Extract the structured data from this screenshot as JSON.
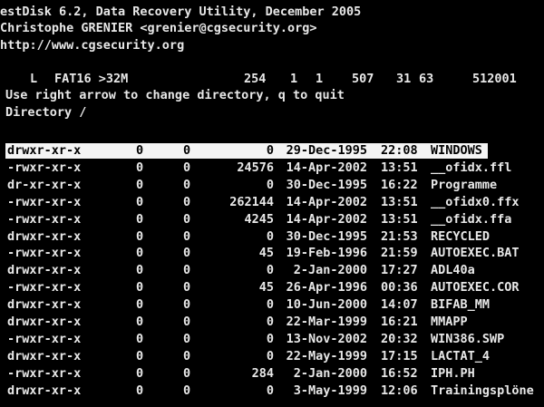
{
  "header": {
    "line1": "estDisk 6.2, Data Recovery Utility, December 2005",
    "line2": "Christophe GRENIER <grenier@cgsecurity.org>",
    "line3": "http://www.cgsecurity.org"
  },
  "partition": {
    "flag": "L",
    "type": "FAT16 >32M",
    "cyl_start": "254",
    "head_start": "1",
    "sec_start": "1",
    "cyl_end": "507",
    "head_end": "31",
    "sec_end": "63",
    "size": "512001"
  },
  "help_text": "Use right arrow to change directory, q to quit",
  "directory_label": "Directory /",
  "entries": [
    {
      "perm": "drwxr-xr-x",
      "uid": "0",
      "gid": "0",
      "size": "0",
      "date": "29-Dec-1995",
      "time": "22:08",
      "name": "WINDOWS"
    },
    {
      "perm": "-rwxr-xr-x",
      "uid": "0",
      "gid": "0",
      "size": "24576",
      "date": "14-Apr-2002",
      "time": "13:51",
      "name": "__ofidx.ffl"
    },
    {
      "perm": "dr-xr-xr-x",
      "uid": "0",
      "gid": "0",
      "size": "0",
      "date": "30-Dec-1995",
      "time": "16:22",
      "name": "Programme"
    },
    {
      "perm": "-rwxr-xr-x",
      "uid": "0",
      "gid": "0",
      "size": "262144",
      "date": "14-Apr-2002",
      "time": "13:51",
      "name": "__ofidx0.ffx"
    },
    {
      "perm": "-rwxr-xr-x",
      "uid": "0",
      "gid": "0",
      "size": "4245",
      "date": "14-Apr-2002",
      "time": "13:51",
      "name": "__ofidx.ffa"
    },
    {
      "perm": "drwxr-xr-x",
      "uid": "0",
      "gid": "0",
      "size": "0",
      "date": "30-Dec-1995",
      "time": "21:53",
      "name": "RECYCLED"
    },
    {
      "perm": "-rwxr-xr-x",
      "uid": "0",
      "gid": "0",
      "size": "45",
      "date": "19-Feb-1996",
      "time": "21:59",
      "name": "AUTOEXEC.BAT"
    },
    {
      "perm": "drwxr-xr-x",
      "uid": "0",
      "gid": "0",
      "size": "0",
      "date": "2-Jan-2000",
      "time": "17:27",
      "name": "ADL40a"
    },
    {
      "perm": "-rwxr-xr-x",
      "uid": "0",
      "gid": "0",
      "size": "45",
      "date": "26-Apr-1996",
      "time": "00:36",
      "name": "AUTOEXEC.COR"
    },
    {
      "perm": "drwxr-xr-x",
      "uid": "0",
      "gid": "0",
      "size": "0",
      "date": "10-Jun-2000",
      "time": "14:07",
      "name": "BIFAB_MM"
    },
    {
      "perm": "drwxr-xr-x",
      "uid": "0",
      "gid": "0",
      "size": "0",
      "date": "22-Mar-1999",
      "time": "16:21",
      "name": "MMAPP"
    },
    {
      "perm": "-rwxr-xr-x",
      "uid": "0",
      "gid": "0",
      "size": "0",
      "date": "13-Nov-2002",
      "time": "20:32",
      "name": "WIN386.SWP"
    },
    {
      "perm": "drwxr-xr-x",
      "uid": "0",
      "gid": "0",
      "size": "0",
      "date": "22-May-1999",
      "time": "17:15",
      "name": "LACTAT_4"
    },
    {
      "perm": "-rwxr-xr-x",
      "uid": "0",
      "gid": "0",
      "size": "284",
      "date": "2-Jan-2000",
      "time": "16:52",
      "name": "IPH.PH"
    },
    {
      "perm": "drwxr-xr-x",
      "uid": "0",
      "gid": "0",
      "size": "0",
      "date": "3-May-1999",
      "time": "12:06",
      "name": "Trainingsplöne"
    }
  ],
  "selected_index": 0,
  "colors": {
    "background": "#000000",
    "foreground": "#e8e8e8",
    "highlight_bg": "#f4f4f4",
    "highlight_fg": "#000000"
  }
}
